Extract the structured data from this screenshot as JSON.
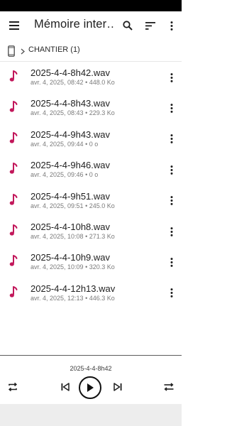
{
  "app_bar": {
    "title": "Mémoire inter…",
    "menu_icon": "menu-icon",
    "search_icon": "search-icon",
    "sort_icon": "sort-icon",
    "more_icon": "more-vert-icon"
  },
  "breadcrumb": {
    "device_icon": "phone-icon",
    "separator_icon": "chevron-right-icon",
    "folder": "CHANTIER (1)"
  },
  "files": [
    {
      "name": "2025-4-4-8h42.wav",
      "date": "avr. 4, 2025, 08:42",
      "size": "448.0 Ko"
    },
    {
      "name": "2025-4-4-8h43.wav",
      "date": "avr. 4, 2025, 08:43",
      "size": "229.3 Ko"
    },
    {
      "name": "2025-4-4-9h43.wav",
      "date": "avr. 4, 2025, 09:44",
      "size": "0 o"
    },
    {
      "name": "2025-4-4-9h46.wav",
      "date": "avr. 4, 2025, 09:46",
      "size": "0 o"
    },
    {
      "name": "2025-4-4-9h51.wav",
      "date": "avr. 4, 2025, 09:51",
      "size": "245.0 Ko"
    },
    {
      "name": "2025-4-4-10h8.wav",
      "date": "avr. 4, 2025, 10:08",
      "size": "271.3 Ko"
    },
    {
      "name": "2025-4-4-10h9.wav",
      "date": "avr. 4, 2025, 10:09",
      "size": "320.3 Ko"
    },
    {
      "name": "2025-4-4-12h13.wav",
      "date": "avr. 4, 2025, 12:13",
      "size": "446.3 Ko"
    }
  ],
  "meta_separator": "•",
  "player": {
    "now_playing": "2025-4-4-8h42",
    "repeat_icon": "repeat-icon",
    "prev_icon": "skip-previous-icon",
    "play_icon": "play-icon",
    "next_icon": "skip-next-icon",
    "shuffle_icon": "shuffle-icon"
  },
  "colors": {
    "accent": "#c2185b",
    "text": "#1f1f1f",
    "secondary_text": "#7a7a7a"
  }
}
